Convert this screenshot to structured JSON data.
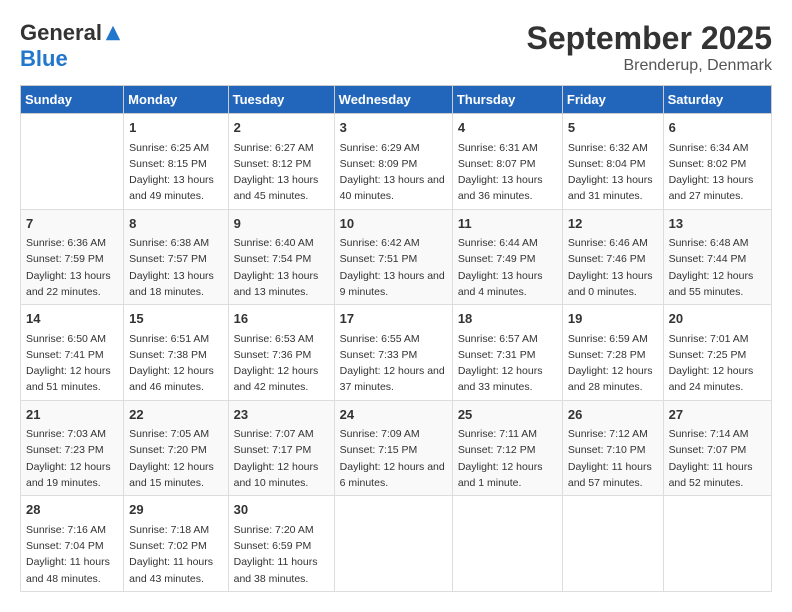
{
  "header": {
    "logo_general": "General",
    "logo_blue": "Blue",
    "month_title": "September 2025",
    "location": "Brenderup, Denmark"
  },
  "days_of_week": [
    "Sunday",
    "Monday",
    "Tuesday",
    "Wednesday",
    "Thursday",
    "Friday",
    "Saturday"
  ],
  "weeks": [
    [
      {
        "day": "",
        "sunrise": "",
        "sunset": "",
        "daylight": ""
      },
      {
        "day": "1",
        "sunrise": "Sunrise: 6:25 AM",
        "sunset": "Sunset: 8:15 PM",
        "daylight": "Daylight: 13 hours and 49 minutes."
      },
      {
        "day": "2",
        "sunrise": "Sunrise: 6:27 AM",
        "sunset": "Sunset: 8:12 PM",
        "daylight": "Daylight: 13 hours and 45 minutes."
      },
      {
        "day": "3",
        "sunrise": "Sunrise: 6:29 AM",
        "sunset": "Sunset: 8:09 PM",
        "daylight": "Daylight: 13 hours and 40 minutes."
      },
      {
        "day": "4",
        "sunrise": "Sunrise: 6:31 AM",
        "sunset": "Sunset: 8:07 PM",
        "daylight": "Daylight: 13 hours and 36 minutes."
      },
      {
        "day": "5",
        "sunrise": "Sunrise: 6:32 AM",
        "sunset": "Sunset: 8:04 PM",
        "daylight": "Daylight: 13 hours and 31 minutes."
      },
      {
        "day": "6",
        "sunrise": "Sunrise: 6:34 AM",
        "sunset": "Sunset: 8:02 PM",
        "daylight": "Daylight: 13 hours and 27 minutes."
      }
    ],
    [
      {
        "day": "7",
        "sunrise": "Sunrise: 6:36 AM",
        "sunset": "Sunset: 7:59 PM",
        "daylight": "Daylight: 13 hours and 22 minutes."
      },
      {
        "day": "8",
        "sunrise": "Sunrise: 6:38 AM",
        "sunset": "Sunset: 7:57 PM",
        "daylight": "Daylight: 13 hours and 18 minutes."
      },
      {
        "day": "9",
        "sunrise": "Sunrise: 6:40 AM",
        "sunset": "Sunset: 7:54 PM",
        "daylight": "Daylight: 13 hours and 13 minutes."
      },
      {
        "day": "10",
        "sunrise": "Sunrise: 6:42 AM",
        "sunset": "Sunset: 7:51 PM",
        "daylight": "Daylight: 13 hours and 9 minutes."
      },
      {
        "day": "11",
        "sunrise": "Sunrise: 6:44 AM",
        "sunset": "Sunset: 7:49 PM",
        "daylight": "Daylight: 13 hours and 4 minutes."
      },
      {
        "day": "12",
        "sunrise": "Sunrise: 6:46 AM",
        "sunset": "Sunset: 7:46 PM",
        "daylight": "Daylight: 13 hours and 0 minutes."
      },
      {
        "day": "13",
        "sunrise": "Sunrise: 6:48 AM",
        "sunset": "Sunset: 7:44 PM",
        "daylight": "Daylight: 12 hours and 55 minutes."
      }
    ],
    [
      {
        "day": "14",
        "sunrise": "Sunrise: 6:50 AM",
        "sunset": "Sunset: 7:41 PM",
        "daylight": "Daylight: 12 hours and 51 minutes."
      },
      {
        "day": "15",
        "sunrise": "Sunrise: 6:51 AM",
        "sunset": "Sunset: 7:38 PM",
        "daylight": "Daylight: 12 hours and 46 minutes."
      },
      {
        "day": "16",
        "sunrise": "Sunrise: 6:53 AM",
        "sunset": "Sunset: 7:36 PM",
        "daylight": "Daylight: 12 hours and 42 minutes."
      },
      {
        "day": "17",
        "sunrise": "Sunrise: 6:55 AM",
        "sunset": "Sunset: 7:33 PM",
        "daylight": "Daylight: 12 hours and 37 minutes."
      },
      {
        "day": "18",
        "sunrise": "Sunrise: 6:57 AM",
        "sunset": "Sunset: 7:31 PM",
        "daylight": "Daylight: 12 hours and 33 minutes."
      },
      {
        "day": "19",
        "sunrise": "Sunrise: 6:59 AM",
        "sunset": "Sunset: 7:28 PM",
        "daylight": "Daylight: 12 hours and 28 minutes."
      },
      {
        "day": "20",
        "sunrise": "Sunrise: 7:01 AM",
        "sunset": "Sunset: 7:25 PM",
        "daylight": "Daylight: 12 hours and 24 minutes."
      }
    ],
    [
      {
        "day": "21",
        "sunrise": "Sunrise: 7:03 AM",
        "sunset": "Sunset: 7:23 PM",
        "daylight": "Daylight: 12 hours and 19 minutes."
      },
      {
        "day": "22",
        "sunrise": "Sunrise: 7:05 AM",
        "sunset": "Sunset: 7:20 PM",
        "daylight": "Daylight: 12 hours and 15 minutes."
      },
      {
        "day": "23",
        "sunrise": "Sunrise: 7:07 AM",
        "sunset": "Sunset: 7:17 PM",
        "daylight": "Daylight: 12 hours and 10 minutes."
      },
      {
        "day": "24",
        "sunrise": "Sunrise: 7:09 AM",
        "sunset": "Sunset: 7:15 PM",
        "daylight": "Daylight: 12 hours and 6 minutes."
      },
      {
        "day": "25",
        "sunrise": "Sunrise: 7:11 AM",
        "sunset": "Sunset: 7:12 PM",
        "daylight": "Daylight: 12 hours and 1 minute."
      },
      {
        "day": "26",
        "sunrise": "Sunrise: 7:12 AM",
        "sunset": "Sunset: 7:10 PM",
        "daylight": "Daylight: 11 hours and 57 minutes."
      },
      {
        "day": "27",
        "sunrise": "Sunrise: 7:14 AM",
        "sunset": "Sunset: 7:07 PM",
        "daylight": "Daylight: 11 hours and 52 minutes."
      }
    ],
    [
      {
        "day": "28",
        "sunrise": "Sunrise: 7:16 AM",
        "sunset": "Sunset: 7:04 PM",
        "daylight": "Daylight: 11 hours and 48 minutes."
      },
      {
        "day": "29",
        "sunrise": "Sunrise: 7:18 AM",
        "sunset": "Sunset: 7:02 PM",
        "daylight": "Daylight: 11 hours and 43 minutes."
      },
      {
        "day": "30",
        "sunrise": "Sunrise: 7:20 AM",
        "sunset": "Sunset: 6:59 PM",
        "daylight": "Daylight: 11 hours and 38 minutes."
      },
      {
        "day": "",
        "sunrise": "",
        "sunset": "",
        "daylight": ""
      },
      {
        "day": "",
        "sunrise": "",
        "sunset": "",
        "daylight": ""
      },
      {
        "day": "",
        "sunrise": "",
        "sunset": "",
        "daylight": ""
      },
      {
        "day": "",
        "sunrise": "",
        "sunset": "",
        "daylight": ""
      }
    ]
  ]
}
